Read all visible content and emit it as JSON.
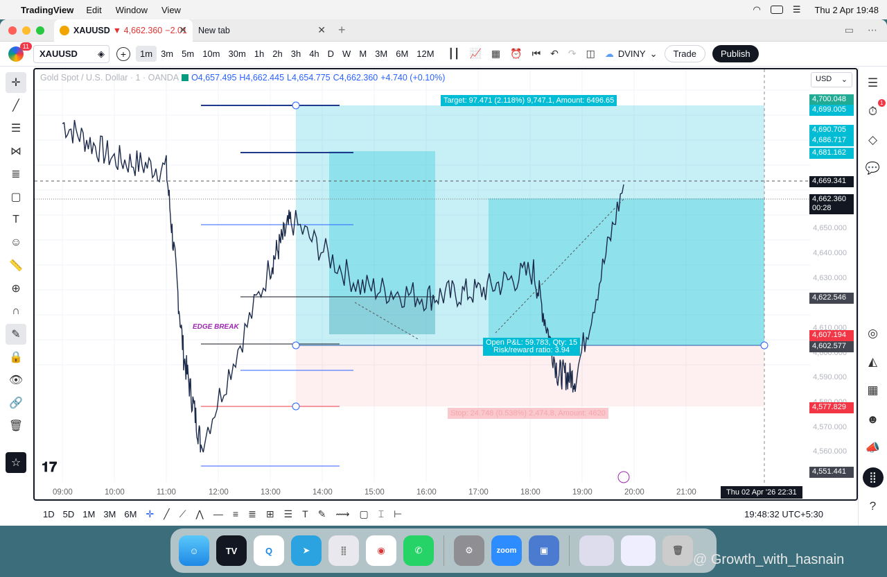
{
  "menubar": {
    "app_name": "TradingView",
    "items": [
      "Edit",
      "Window",
      "View"
    ],
    "clock": "Thu 2 Apr  19:48"
  },
  "tabs": [
    {
      "title": "XAUUSD",
      "price": "▼ 4,662.360",
      "change": "−2.01",
      "active": true
    },
    {
      "title": "New tab",
      "active": false
    }
  ],
  "toolbar": {
    "notification_count": "11",
    "symbol": "XAUUSD",
    "intervals": [
      "1m",
      "3m",
      "5m",
      "10m",
      "30m",
      "1h",
      "2h",
      "3h",
      "4h",
      "D",
      "W",
      "M",
      "3M",
      "6M",
      "12M"
    ],
    "active_interval": "1m",
    "layout_name": "DVINY",
    "trade_label": "Trade",
    "publish_label": "Publish"
  },
  "legend": {
    "title": "Gold Spot / U.S. Dollar · 1 · OANDA",
    "open": "O4,657.495",
    "high": "H4,662.445",
    "low": "L4,654.775",
    "close": "C4,662.360",
    "change": "+4.740 (+0.10%)"
  },
  "currency": "USD",
  "price_labels": [
    {
      "text": "4,700.048",
      "color": "#22ab94"
    },
    {
      "text": "4,699.005",
      "color": "#00bcd4"
    },
    {
      "text": "4,690.705",
      "color": "#00bcd4"
    },
    {
      "text": "4,686.717",
      "color": "#00bcd4"
    },
    {
      "text": "4,681.162",
      "color": "#00bcd4"
    },
    {
      "text": "4,669.341",
      "color": "#131722"
    },
    {
      "text": "4,662.360",
      "color": "#131722"
    },
    {
      "text": "00:28",
      "color": "#131722"
    },
    {
      "text": "4,622.546",
      "color": "#434651"
    },
    {
      "text": "4,607.194",
      "color": "#f23645"
    },
    {
      "text": "4,602.577",
      "color": "#434651"
    },
    {
      "text": "4,577.829",
      "color": "#f23645"
    },
    {
      "text": "4,551.441",
      "color": "#434651"
    }
  ],
  "axis_prices": [
    "4,650.000",
    "4,640.000",
    "4,630.000",
    "4,610.000",
    "4,600.000",
    "4,590.000",
    "4,580.000",
    "4,570.000",
    "4,560.000"
  ],
  "time_axis": [
    "09:00",
    "10:00",
    "11:00",
    "12:00",
    "13:00",
    "14:00",
    "15:00",
    "16:00",
    "17:00",
    "18:00",
    "19:00",
    "20:00",
    "21:00"
  ],
  "crosshair_date": "Thu 02 Apr '26   22:31",
  "position": {
    "target_label": "Target: 97.471 (2.118%) 9,747.1, Amount: 6496.65",
    "open_label": "Open P&L: 59.783, Qty: 15",
    "rr_label": "Risk/reward ratio: 3.94",
    "stop_label": "Stop: 24.748 (0.538%) 2,474.8, Amount: 4620"
  },
  "annotation": "EDGE BREAK",
  "bottom": {
    "ranges": [
      "1D",
      "5D",
      "1M",
      "3M",
      "6M"
    ],
    "time": "19:48:32 UTC+5:30"
  },
  "dock_apps": [
    "Finder",
    "TradingView",
    "QuickTime",
    "Telegram",
    "Launchpad",
    "Chrome",
    "WhatsApp",
    "Settings",
    "Zoom",
    "Cleaner"
  ],
  "watermark": "@ Growth_with_hasnain",
  "chart_data": {
    "type": "line",
    "symbol": "XAUUSD",
    "x": [
      "09:00",
      "10:00",
      "11:00",
      "11:30",
      "12:00",
      "13:00",
      "14:00",
      "15:00",
      "16:00",
      "17:00",
      "18:00",
      "18:40",
      "19:00",
      "19:40"
    ],
    "y": [
      4686,
      4672,
      4668,
      4595,
      4560,
      4630,
      4648,
      4622,
      4618,
      4620,
      4628,
      4588,
      4586,
      4662
    ],
    "ylim": [
      4551,
      4705
    ]
  }
}
